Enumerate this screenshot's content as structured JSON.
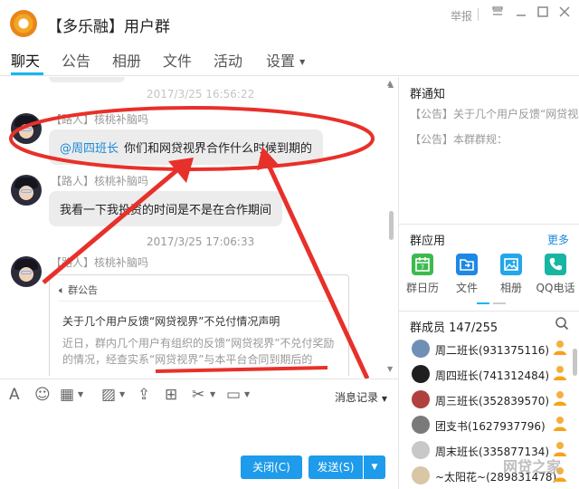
{
  "window": {
    "title": "【多乐融】用户群",
    "report_label": "举报"
  },
  "tabs": [
    {
      "label": "聊天",
      "active": true
    },
    {
      "label": "公告"
    },
    {
      "label": "相册"
    },
    {
      "label": "文件"
    },
    {
      "label": "活动"
    },
    {
      "label": "设置"
    }
  ],
  "chat": {
    "partial_timestamp": "2017/3/25 16:56:22",
    "messages": [
      {
        "sender": "【路人】核桃补脑吗",
        "mention": "@周四班长",
        "text": "你们和网贷视界合作什么时候到期的"
      },
      {
        "sender": "【路人】核桃补脑吗",
        "text": "我看一下我投资的时间是不是在合作期间"
      }
    ],
    "timestamp_2": "2017/3/25 17:06:33",
    "announcement_message": {
      "sender": "【路人】核桃补脑吗",
      "header": "群公告",
      "title": "关于几个用户反馈“网贷视界”不兑付情况声明",
      "body": "近日，群内几个用户有组织的反馈“网贷视界”不兑付奖励的情况，经查实系“网贷视界”与本平台合同到期后的"
    }
  },
  "toolbar": {
    "history_label": "消息记录"
  },
  "buttons": {
    "close_label": "关闭(C)",
    "send_label": "发送(S)"
  },
  "right_panel": {
    "notice_title": "群通知",
    "notices": [
      "【公告】关于几个用户反馈“网贷视界”不兑付情况声明",
      "【公告】本群群规："
    ],
    "apps_title": "群应用",
    "apps_more": "更多",
    "apps": [
      {
        "label": "群日历",
        "icon": "calendar-icon",
        "color": "#3dba4e"
      },
      {
        "label": "文件",
        "icon": "folder-icon",
        "color": "#1e88e5"
      },
      {
        "label": "相册",
        "icon": "photo-icon",
        "color": "#22a7e8"
      },
      {
        "label": "QQ电话",
        "icon": "phone-icon",
        "color": "#17b5a3"
      }
    ],
    "members_title": "群成员 147/255",
    "members": [
      {
        "name": "周二班长(931375116)",
        "color": "#6f8fb5"
      },
      {
        "name": "周四班长(741312484)",
        "color": "#1f1f1f"
      },
      {
        "name": "周三班长(352839570)",
        "color": "#b0413e"
      },
      {
        "name": "团支书(1627937796)",
        "color": "#7a7a7a"
      },
      {
        "name": "周末班长(335877134)",
        "color": "#c8c8c8"
      },
      {
        "name": "~太阳花~(289831478)",
        "color": "#d9c6a5"
      }
    ]
  },
  "watermark": "网贷之家"
}
